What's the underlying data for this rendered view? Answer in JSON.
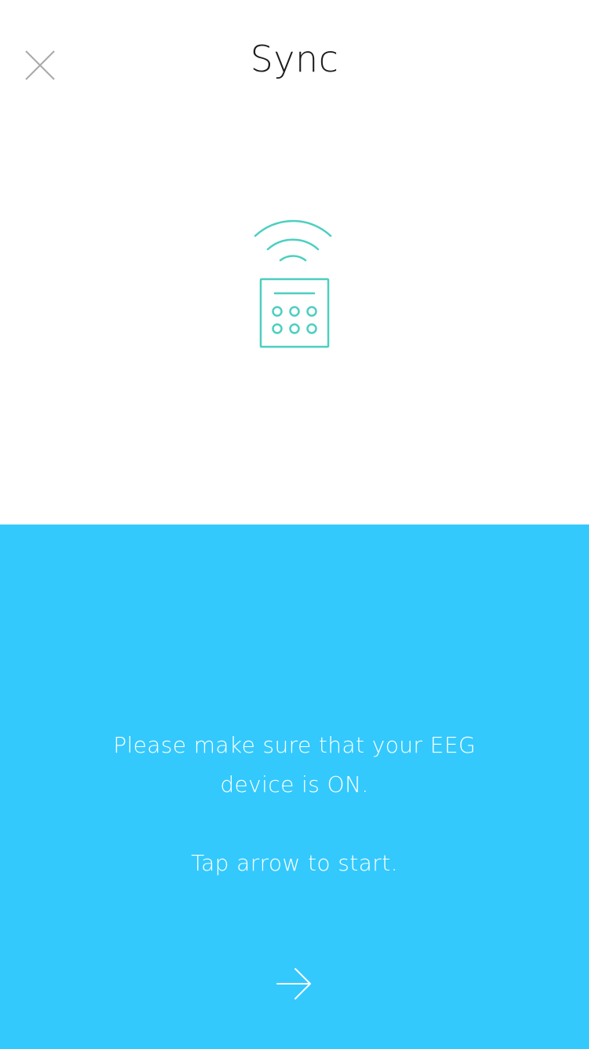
{
  "header": {
    "title": "Sync",
    "close_icon": "close-icon"
  },
  "illustration": {
    "icon": "eeg-device-wireless-icon",
    "color": "#4ccfc0"
  },
  "panel": {
    "background": "#33c9fd",
    "message": "Please make sure that your EEG device is ON.",
    "instruction": "Tap arrow to start.",
    "next_icon": "arrow-right-icon"
  }
}
